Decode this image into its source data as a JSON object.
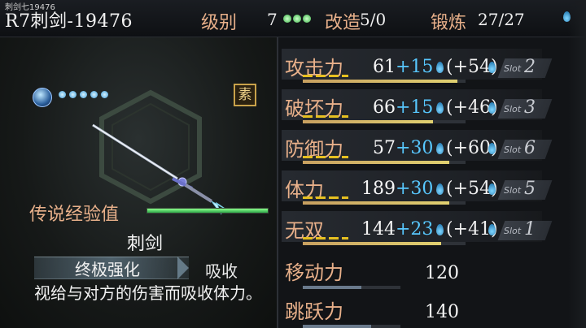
{
  "header": {
    "tiny_title": "刺剑七19476",
    "weapon_title": "R7刺剑-19476",
    "level_label": "级别",
    "level_value": "7",
    "mod_label": "改造",
    "mod_value": "5/0",
    "forge_label": "锻炼",
    "forge_value": "27/27"
  },
  "left": {
    "badge": "素",
    "exp_label": "传说经验值",
    "exp_fraction": 1.0,
    "weapon_name": "刺剑",
    "skill_name": "终极强化",
    "skill_tag": "吸收",
    "description": "视给与对方的伤害而吸收体力。"
  },
  "stats": [
    {
      "label": "攻击力",
      "base": "61",
      "bonus": "+15",
      "extra": "(+54)",
      "slot_label": "Slot",
      "slot": "2",
      "bar": 0.95
    },
    {
      "label": "破坏力",
      "base": "66",
      "bonus": "+15",
      "extra": "(+46)",
      "slot_label": "Slot",
      "slot": "3",
      "bar": 0.8
    },
    {
      "label": "防御力",
      "base": "57",
      "bonus": "+30",
      "extra": "(+60)",
      "slot_label": "Slot",
      "slot": "6",
      "bar": 0.9
    },
    {
      "label": "体力",
      "base": "189",
      "bonus": "+30",
      "extra": "(+54)",
      "slot_label": "Slot",
      "slot": "5",
      "bar": 0.9
    },
    {
      "label": "无双",
      "base": "144",
      "bonus": "+23",
      "extra": "(+41)",
      "slot_label": "Slot",
      "slot": "1",
      "bar": 0.85
    }
  ],
  "simple_stats": [
    {
      "label": "移动力",
      "value": "120",
      "bar": 0.6
    },
    {
      "label": "跳跃力",
      "value": "140",
      "bar": 0.7
    }
  ],
  "colors": {
    "label_orange": "#e8b08a",
    "bonus_blue": "#58c8ff",
    "exp_green": "#2ea84a"
  }
}
